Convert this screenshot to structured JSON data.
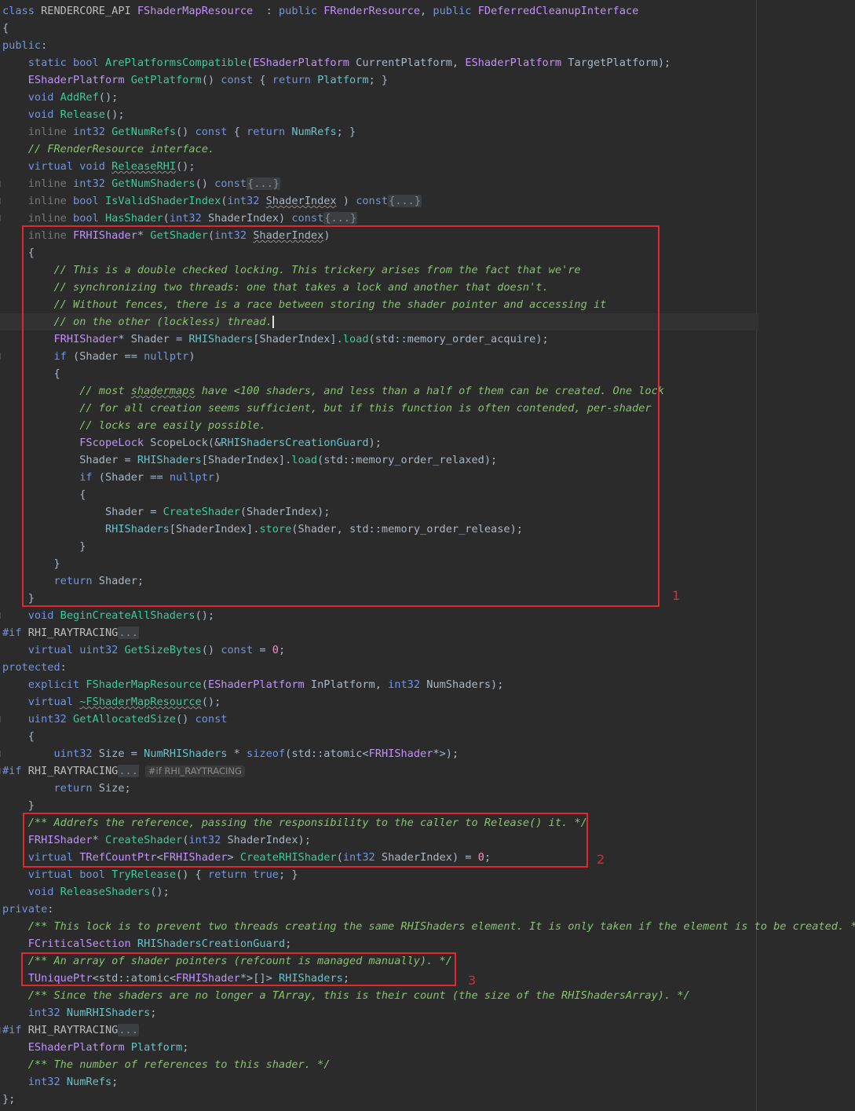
{
  "annotations": [
    "1",
    "2",
    "3"
  ],
  "inlay_hint": "#if RHI_RAYTRACING",
  "fold_placeholder": "{...}",
  "fold_dots": "...",
  "lines": [
    [
      [
        "kw",
        "class "
      ],
      [
        "macro",
        "RENDERCORE_API "
      ],
      [
        "type",
        "FShaderMapResource"
      ],
      [
        "",
        "  : "
      ],
      [
        "kw",
        "public "
      ],
      [
        "type",
        "FRenderResource"
      ],
      [
        "",
        ", "
      ],
      [
        "kw",
        "public "
      ],
      [
        "type",
        "FDeferredCleanupInterface"
      ]
    ],
    [
      [
        "",
        "{"
      ]
    ],
    [
      [
        "kw",
        "public"
      ],
      [
        "",
        ":"
      ]
    ],
    [
      [
        "",
        "    "
      ],
      [
        "kw",
        "static bool "
      ],
      [
        "fn",
        "ArePlatformsCompatible"
      ],
      [
        "",
        "("
      ],
      [
        "type",
        "EShaderPlatform "
      ],
      [
        "",
        "CurrentPlatform, "
      ],
      [
        "type",
        "EShaderPlatform "
      ],
      [
        "",
        "TargetPlatform);"
      ]
    ],
    [
      [
        "",
        "    "
      ],
      [
        "type",
        "EShaderPlatform "
      ],
      [
        "fn",
        "GetPlatform"
      ],
      [
        "",
        "() "
      ],
      [
        "kw",
        "const "
      ],
      [
        "",
        "{ "
      ],
      [
        "kw",
        "return "
      ],
      [
        "field",
        "Platform"
      ],
      [
        "",
        "; }"
      ]
    ],
    [
      [
        "",
        "    "
      ],
      [
        "kw",
        "void "
      ],
      [
        "fn",
        "AddRef"
      ],
      [
        "",
        "();"
      ]
    ],
    [
      [
        "",
        "    "
      ],
      [
        "kw",
        "void "
      ],
      [
        "fn",
        "Release"
      ],
      [
        "",
        "();"
      ]
    ],
    [
      [
        "",
        "    "
      ],
      [
        "dim",
        "inline "
      ],
      [
        "kw",
        "int32 "
      ],
      [
        "fn",
        "GetNumRefs"
      ],
      [
        "",
        "() "
      ],
      [
        "kw",
        "const "
      ],
      [
        "",
        "{ "
      ],
      [
        "kw",
        "return "
      ],
      [
        "field",
        "NumRefs"
      ],
      [
        "",
        "; }"
      ]
    ],
    [
      [
        "",
        "    "
      ],
      [
        "cmt",
        "// FRenderResource interface."
      ]
    ],
    [
      [
        "",
        "    "
      ],
      [
        "kw",
        "virtual void "
      ],
      [
        "fnsq",
        "ReleaseRHI"
      ],
      [
        "",
        "();"
      ]
    ],
    [
      [
        "",
        "    "
      ],
      [
        "dim",
        "inline "
      ],
      [
        "kw",
        "int32 "
      ],
      [
        "fn",
        "GetNumShaders"
      ],
      [
        "",
        "() "
      ],
      [
        "kw",
        "const"
      ],
      [
        "foldb",
        "{...}"
      ]
    ],
    [
      [
        "",
        "    "
      ],
      [
        "dim",
        "inline "
      ],
      [
        "kw",
        "bool "
      ],
      [
        "fn",
        "IsValidShaderIndex"
      ],
      [
        "",
        "("
      ],
      [
        "kw",
        "int32 "
      ],
      [
        "sq",
        "ShaderIndex"
      ],
      [
        "",
        " ) "
      ],
      [
        "kw",
        "const"
      ],
      [
        "foldb",
        "{...}"
      ]
    ],
    [
      [
        "",
        "    "
      ],
      [
        "dim",
        "inline "
      ],
      [
        "kw",
        "bool "
      ],
      [
        "fn",
        "HasShader"
      ],
      [
        "",
        "("
      ],
      [
        "kw",
        "int32 "
      ],
      [
        "",
        "ShaderIndex) "
      ],
      [
        "kw",
        "const"
      ],
      [
        "foldb",
        "{...}"
      ]
    ],
    [
      [
        "",
        "    "
      ],
      [
        "dim",
        "inline "
      ],
      [
        "type",
        "FRHIShader"
      ],
      [
        "",
        "* "
      ],
      [
        "fn",
        "GetShader"
      ],
      [
        "",
        "("
      ],
      [
        "kw",
        "int32 "
      ],
      [
        "sq",
        "ShaderIndex"
      ],
      [
        "",
        ")"
      ]
    ],
    [
      [
        "",
        "    {"
      ]
    ],
    [
      [
        "",
        "        "
      ],
      [
        "cmt",
        "// This is a double checked locking. This trickery arises from the fact that we're"
      ]
    ],
    [
      [
        "",
        "        "
      ],
      [
        "cmt",
        "// synchronizing two threads: one that takes a lock and another that doesn't."
      ]
    ],
    [
      [
        "",
        "        "
      ],
      [
        "cmt",
        "// Without fences, there is a race between storing the shader pointer and accessing it"
      ]
    ],
    [
      [
        "",
        "        "
      ],
      [
        "cmt",
        "// on the other (lockless) thread."
      ],
      [
        "caret",
        ""
      ]
    ],
    [
      [
        "",
        "        "
      ],
      [
        "type",
        "FRHIShader"
      ],
      [
        "",
        "* Shader = "
      ],
      [
        "field",
        "RHIShaders"
      ],
      [
        "",
        "[ShaderIndex]."
      ],
      [
        "fn",
        "load"
      ],
      [
        "",
        "("
      ],
      [
        "ns",
        "std"
      ],
      [
        "",
        "::memory_order_acquire);"
      ]
    ],
    [
      [
        "",
        "        "
      ],
      [
        "kw",
        "if "
      ],
      [
        "",
        "(Shader == "
      ],
      [
        "kw",
        "nullptr"
      ],
      [
        "",
        ")"
      ]
    ],
    [
      [
        "",
        "        {"
      ]
    ],
    [
      [
        "",
        "            "
      ],
      [
        "cmt",
        "// most "
      ],
      [
        "cmtsq",
        "shadermaps"
      ],
      [
        "cmt",
        " have <100 shaders, and less than a half of them can be created. One lock"
      ]
    ],
    [
      [
        "",
        "            "
      ],
      [
        "cmt",
        "// for all creation seems sufficient, but if this function is often contended, per-shader"
      ]
    ],
    [
      [
        "",
        "            "
      ],
      [
        "cmt",
        "// locks are easily possible."
      ]
    ],
    [
      [
        "",
        "            "
      ],
      [
        "type",
        "FScopeLock "
      ],
      [
        "",
        "ScopeLock(&"
      ],
      [
        "field",
        "RHIShadersCreationGuard"
      ],
      [
        "",
        ");"
      ]
    ],
    [
      [
        "",
        "            Shader = "
      ],
      [
        "field",
        "RHIShaders"
      ],
      [
        "",
        "[ShaderIndex]."
      ],
      [
        "fn",
        "load"
      ],
      [
        "",
        "("
      ],
      [
        "ns",
        "std"
      ],
      [
        "",
        "::memory_order_relaxed);"
      ]
    ],
    [
      [
        "",
        "            "
      ],
      [
        "kw",
        "if "
      ],
      [
        "",
        "(Shader == "
      ],
      [
        "kw",
        "nullptr"
      ],
      [
        "",
        ")"
      ]
    ],
    [
      [
        "",
        "            {"
      ]
    ],
    [
      [
        "",
        "                Shader = "
      ],
      [
        "fn",
        "CreateShader"
      ],
      [
        "",
        "(ShaderIndex);"
      ]
    ],
    [
      [
        "",
        "                "
      ],
      [
        "field",
        "RHIShaders"
      ],
      [
        "",
        "[ShaderIndex]."
      ],
      [
        "fn",
        "store"
      ],
      [
        "",
        "(Shader, "
      ],
      [
        "ns",
        "std"
      ],
      [
        "",
        "::memory_order_release);"
      ]
    ],
    [
      [
        "",
        "            }"
      ]
    ],
    [
      [
        "",
        "        }"
      ]
    ],
    [
      [
        "",
        "        "
      ],
      [
        "kw",
        "return "
      ],
      [
        "",
        "Shader;"
      ]
    ],
    [
      [
        "",
        "    }"
      ]
    ],
    [
      [
        "",
        "    "
      ],
      [
        "kw",
        "void "
      ],
      [
        "fn",
        "BeginCreateAllShaders"
      ],
      [
        "",
        "();"
      ]
    ],
    [
      [
        "kw",
        "#if "
      ],
      [
        "macro",
        "RHI_RAYTRACING"
      ],
      [
        "foldd",
        "..."
      ]
    ],
    [
      [
        "",
        "    "
      ],
      [
        "kw",
        "virtual "
      ],
      [
        "kw",
        "uint32 "
      ],
      [
        "fn",
        "GetSizeBytes"
      ],
      [
        "",
        "() "
      ],
      [
        "kw",
        "const "
      ],
      [
        "",
        "= "
      ],
      [
        "num",
        "0"
      ],
      [
        "",
        ";"
      ]
    ],
    [
      [
        "kw",
        "protected"
      ],
      [
        "",
        ":"
      ]
    ],
    [
      [
        "",
        "    "
      ],
      [
        "kw",
        "explicit "
      ],
      [
        "fn",
        "FShaderMapResource"
      ],
      [
        "",
        "("
      ],
      [
        "type",
        "EShaderPlatform "
      ],
      [
        "",
        "InPlatform, "
      ],
      [
        "kw",
        "int32 "
      ],
      [
        "",
        "NumShaders);"
      ]
    ],
    [
      [
        "",
        "    "
      ],
      [
        "kw",
        "virtual "
      ],
      [
        "fnsq",
        "~FShaderMapResource"
      ],
      [
        "",
        "();"
      ]
    ],
    [
      [
        "",
        "    "
      ],
      [
        "kw",
        "uint32 "
      ],
      [
        "fn",
        "GetAllocatedSize"
      ],
      [
        "",
        "() "
      ],
      [
        "kw",
        "const"
      ]
    ],
    [
      [
        "",
        "    {"
      ]
    ],
    [
      [
        "",
        "        "
      ],
      [
        "kw",
        "uint32 "
      ],
      [
        "",
        "Size = "
      ],
      [
        "field",
        "NumRHIShaders"
      ],
      [
        "",
        " * "
      ],
      [
        "kw",
        "sizeof"
      ],
      [
        "",
        "("
      ],
      [
        "ns",
        "std"
      ],
      [
        "",
        "::atomic<"
      ],
      [
        "type",
        "FRHIShader"
      ],
      [
        "",
        "*>);"
      ]
    ],
    [
      [
        "kw",
        "#if "
      ],
      [
        "macro",
        "RHI_RAYTRACING"
      ],
      [
        "foldd",
        "..."
      ],
      [
        "hint",
        ""
      ]
    ],
    [
      [
        "",
        "        "
      ],
      [
        "kw",
        "return "
      ],
      [
        "",
        "Size;"
      ]
    ],
    [
      [
        "",
        "    }"
      ]
    ],
    [
      [
        "",
        "    "
      ],
      [
        "cmt",
        "/** Addrefs the reference, passing the responsibility to the caller to Release() it. */"
      ]
    ],
    [
      [
        "",
        "    "
      ],
      [
        "type",
        "FRHIShader"
      ],
      [
        "",
        "* "
      ],
      [
        "fn",
        "CreateShader"
      ],
      [
        "",
        "("
      ],
      [
        "kw",
        "int32 "
      ],
      [
        "",
        "ShaderIndex);"
      ]
    ],
    [
      [
        "",
        "    "
      ],
      [
        "kw",
        "virtual "
      ],
      [
        "type",
        "TRefCountPtr"
      ],
      [
        "",
        "<"
      ],
      [
        "type",
        "FRHIShader"
      ],
      [
        "",
        "> "
      ],
      [
        "fn",
        "CreateRHIShader"
      ],
      [
        "",
        "("
      ],
      [
        "kw",
        "int32 "
      ],
      [
        "",
        "ShaderIndex) = "
      ],
      [
        "num",
        "0"
      ],
      [
        "",
        ";"
      ]
    ],
    [
      [
        "",
        "    "
      ],
      [
        "kw",
        "virtual bool "
      ],
      [
        "fn",
        "TryRelease"
      ],
      [
        "",
        "() { "
      ],
      [
        "kw",
        "return true"
      ],
      [
        "",
        "; }"
      ]
    ],
    [
      [
        "",
        "    "
      ],
      [
        "kw",
        "void "
      ],
      [
        "fn",
        "ReleaseShaders"
      ],
      [
        "",
        "();"
      ]
    ],
    [
      [
        "kw",
        "private"
      ],
      [
        "",
        ":"
      ]
    ],
    [
      [
        "",
        "    "
      ],
      [
        "cmt",
        "/** This lock is to prevent two threads creating the same RHIShaders element. It is only taken if the element is to be created. */"
      ]
    ],
    [
      [
        "",
        "    "
      ],
      [
        "type",
        "FCriticalSection "
      ],
      [
        "field",
        "RHIShadersCreationGuard"
      ],
      [
        "",
        ";"
      ]
    ],
    [
      [
        "",
        "    "
      ],
      [
        "cmt",
        "/** An array of shader pointers (refcount is managed manually). */"
      ]
    ],
    [
      [
        "",
        "    "
      ],
      [
        "type",
        "TUniquePtr"
      ],
      [
        "",
        "<"
      ],
      [
        "ns",
        "std"
      ],
      [
        "",
        "::atomic<"
      ],
      [
        "type",
        "FRHIShader"
      ],
      [
        "",
        "*>[]> "
      ],
      [
        "field",
        "RHIShaders"
      ],
      [
        "",
        ";"
      ]
    ],
    [
      [
        "",
        "    "
      ],
      [
        "cmt",
        "/** Since the shaders are no longer a TArray, this is their count (the size of the RHIShadersArray). */"
      ]
    ],
    [
      [
        "",
        "    "
      ],
      [
        "kw",
        "int32 "
      ],
      [
        "field",
        "NumRHIShaders"
      ],
      [
        "",
        ";"
      ]
    ],
    [
      [
        "kw",
        "#if "
      ],
      [
        "macro",
        "RHI_RAYTRACING"
      ],
      [
        "foldd",
        "..."
      ]
    ],
    [
      [
        "",
        "    "
      ],
      [
        "type",
        "EShaderPlatform "
      ],
      [
        "field",
        "Platform"
      ],
      [
        "",
        ";"
      ]
    ],
    [
      [
        "",
        "    "
      ],
      [
        "cmt",
        "/** The number of references to this shader. */"
      ]
    ],
    [
      [
        "",
        "    "
      ],
      [
        "kw",
        "int32 "
      ],
      [
        "field",
        "NumRefs"
      ],
      [
        "",
        ";"
      ]
    ],
    [
      [
        "",
        "};"
      ]
    ]
  ]
}
